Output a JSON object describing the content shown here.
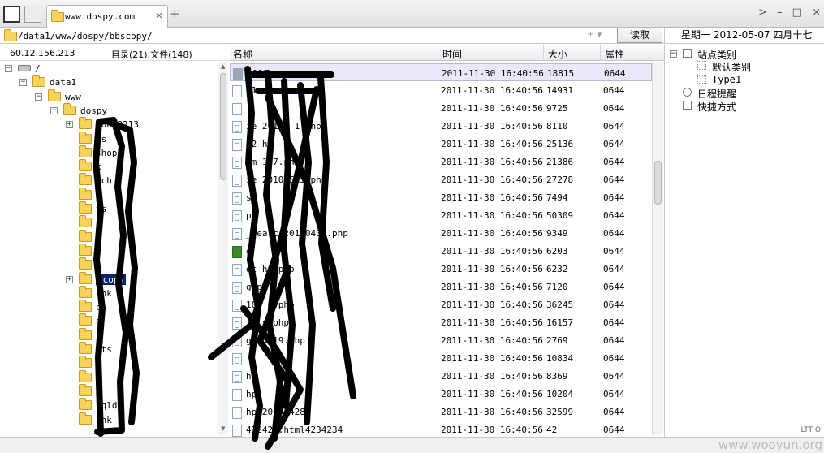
{
  "tabbar": {
    "tab_title": "www.dospy.com",
    "tab_close": "×",
    "new_tab": "+"
  },
  "window_controls": {
    "arrow": ">",
    "minimize": "–",
    "maximize": "□",
    "close": "×"
  },
  "address": {
    "path": "/data1/www/dospy/bbscopy/",
    "controls": "±  ▾",
    "read_button": "读取"
  },
  "datebar": {
    "text": "星期一 2012-05-07 四月十七"
  },
  "tree": {
    "ip": "60.12.156.213",
    "counts": "目录(21),文件(148)",
    "items": [
      {
        "label": "/",
        "pm": "−",
        "kind": "drive"
      },
      {
        "label": "data1",
        "pm": "−",
        "kind": "folder"
      },
      {
        "label": "www",
        "pm": "−",
        "kind": "folder"
      },
      {
        "label": "dospy",
        "pm": "−",
        "kind": "folder"
      },
      {
        "label": "10012213",
        "pm": "+",
        "kind": "folder"
      },
      {
        "label": "ws",
        "pm": "",
        "kind": "folder"
      },
      {
        "label": "shop",
        "pm": "",
        "kind": "folder"
      },
      {
        "label": "x",
        "pm": "",
        "kind": "folder"
      },
      {
        "label": "sch",
        "pm": "",
        "kind": "folder"
      },
      {
        "label": "d",
        "pm": "",
        "kind": "folder"
      },
      {
        "label": "ts",
        "pm": "",
        "kind": "folder"
      },
      {
        "label": "",
        "pm": "",
        "kind": "folder"
      },
      {
        "label": "d",
        "pm": "",
        "kind": "folder"
      },
      {
        "label": "x",
        "pm": "",
        "kind": "folder"
      },
      {
        "label": "n",
        "pm": "",
        "kind": "folder"
      },
      {
        "label": "scopy",
        "pm": "+",
        "kind": "folder",
        "selected": true
      },
      {
        "label": "ink",
        "pm": "",
        "kind": "folder"
      },
      {
        "label": "p",
        "pm": "",
        "kind": "folder"
      },
      {
        "label": "g",
        "pm": "",
        "kind": "folder"
      },
      {
        "label": "i",
        "pm": "",
        "kind": "folder"
      },
      {
        "label": "ots",
        "pm": "",
        "kind": "folder"
      },
      {
        "label": "s",
        "pm": "",
        "kind": "folder"
      },
      {
        "label": "",
        "pm": "",
        "kind": "folder"
      },
      {
        "label": "",
        "pm": "",
        "kind": "folder"
      },
      {
        "label": "sqldb",
        "pm": "",
        "kind": "folder"
      },
      {
        "label": "ink",
        "pm": "",
        "kind": "folder"
      }
    ]
  },
  "filelist": {
    "columns": {
      "name": "名称",
      "time": "时间",
      "size": "大小",
      "attr": "属性"
    },
    "rows": [
      {
        "name": "2009",
        "time": "2011-11-30 16:40:56",
        "size": "18815",
        "attr": "0644",
        "icon": "sel"
      },
      {
        "name": "11",
        "time": "2011-11-30 16:40:56",
        "size": "14931",
        "attr": "0644",
        "icon": "plain"
      },
      {
        "name": "",
        "time": "2011-11-30 16:40:56",
        "size": "9725",
        "attr": "0644",
        "icon": "plain"
      },
      {
        "name": "ie  20100 1.php",
        "time": "2011-11-30 16:40:56",
        "size": "8110",
        "attr": "0644",
        "icon": "doc"
      },
      {
        "name": "m2    hp",
        "time": "2011-11-30 16:40:56",
        "size": "25136",
        "attr": "0644",
        "icon": "doc"
      },
      {
        "name": "em   107.php",
        "time": "2011-11-30 16:40:56",
        "size": "21386",
        "attr": "0644",
        "icon": "doc"
      },
      {
        "name": "ie    20100525.php",
        "time": "2011-11-30 16:40:56",
        "size": "27278",
        "attr": "0644",
        "icon": "doc"
      },
      {
        "name": "s",
        "time": "2011-11-30 16:40:56",
        "size": "7494",
        "attr": "0644",
        "icon": "doc"
      },
      {
        "name": "p",
        "time": "2011-11-30 16:40:56",
        "size": "50309",
        "attr": "0644",
        "icon": "doc"
      },
      {
        "name": "_searc 20100406.php",
        "time": "2011-11-30 16:40:56",
        "size": "9349",
        "attr": "0644",
        "icon": "doc"
      },
      {
        "name": "g",
        "time": "2011-11-30 16:40:56",
        "size": "6203",
        "attr": "0644",
        "icon": "gif"
      },
      {
        "name": "ot_h  .php",
        "time": "2011-11-30 16:40:56",
        "size": "6232",
        "attr": "0644",
        "icon": "doc"
      },
      {
        "name": "g.ph",
        "time": "2011-11-30 16:40:56",
        "size": "7120",
        "attr": "0644",
        "icon": "doc"
      },
      {
        "name": "100 6.php",
        "time": "2011-11-30 16:40:56",
        "size": "36245",
        "attr": "0644",
        "icon": "doc"
      },
      {
        "name": "fo   y.php",
        "time": "2011-11-30 16:40:56",
        "size": "16157",
        "attr": "0644",
        "icon": "doc"
      },
      {
        "name": "ge  0719.php",
        "time": "2011-11-30 16:40:56",
        "size": "2769",
        "attr": "0644",
        "icon": "doc"
      },
      {
        "name": "",
        "time": "2011-11-30 16:40:56",
        "size": "10834",
        "attr": "0644",
        "icon": "doc"
      },
      {
        "name": "hp",
        "time": "2011-11-30 16:40:56",
        "size": "8369",
        "attr": "0644",
        "icon": "doc"
      },
      {
        "name": "hp",
        "time": "2011-11-30 16:40:56",
        "size": "10204",
        "attr": "0644",
        "icon": "plain"
      },
      {
        "name": "hp.20090428",
        "time": "2011-11-30 16:40:56",
        "size": "32599",
        "attr": "0644",
        "icon": "plain"
      },
      {
        "name": "432423.html4234234",
        "time": "2011-11-30 16:40:56",
        "size": "42",
        "attr": "0644",
        "icon": "plain"
      }
    ]
  },
  "rpanel": {
    "items": [
      {
        "label": "站点类别",
        "pm": "−",
        "indent": 0,
        "icon": "box"
      },
      {
        "label": "默认类别",
        "pm": "",
        "indent": 1,
        "icon": "dot"
      },
      {
        "label": "Type1",
        "pm": "",
        "indent": 1,
        "icon": "dot"
      },
      {
        "label": "日程提醒",
        "pm": "",
        "indent": 0,
        "icon": "clock"
      },
      {
        "label": "快捷方式",
        "pm": "",
        "indent": 0,
        "icon": "box"
      }
    ]
  },
  "bottom": {
    "status": "LTT O",
    "watermark": "www.wooyun.org"
  }
}
